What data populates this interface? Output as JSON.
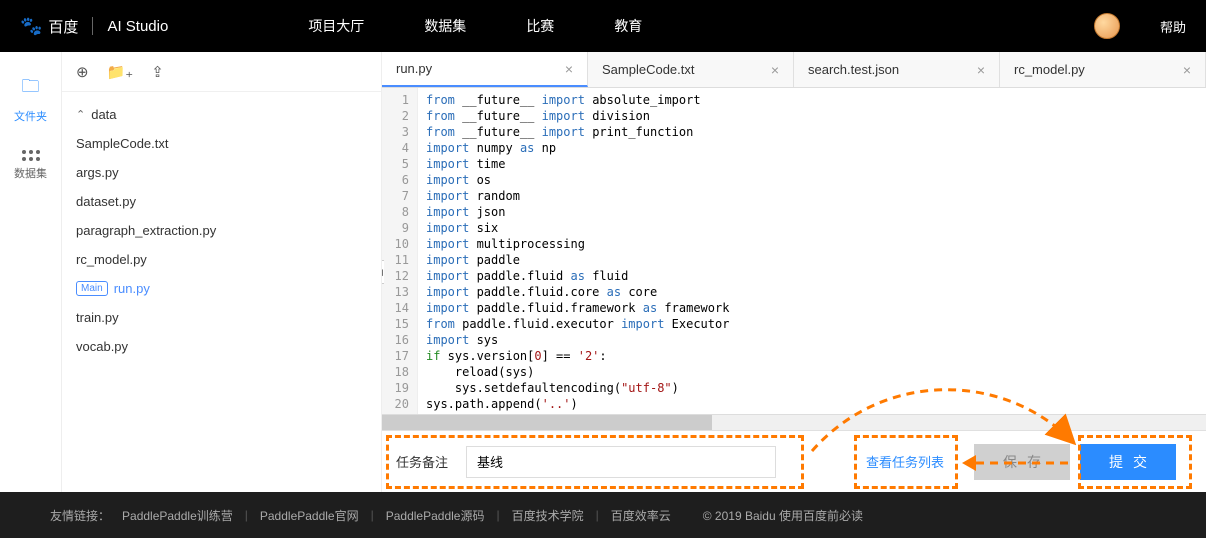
{
  "header": {
    "logo_baidu": "百度",
    "logo_studio": "AI Studio",
    "nav": [
      "项目大厅",
      "数据集",
      "比赛",
      "教育"
    ],
    "help": "帮助"
  },
  "leftcol": {
    "files": {
      "label": "文件夹"
    },
    "datasets": {
      "label": "数据集"
    }
  },
  "filetree": {
    "folder": "data",
    "items": [
      "SampleCode.txt",
      "args.py",
      "dataset.py",
      "paragraph_extraction.py",
      "rc_model.py"
    ],
    "main_tag": "Main",
    "main_file": "run.py",
    "rest": [
      "train.py",
      "vocab.py"
    ]
  },
  "tabs": [
    {
      "label": "run.py",
      "active": true
    },
    {
      "label": "SampleCode.txt",
      "active": false
    },
    {
      "label": "search.test.json",
      "active": false
    },
    {
      "label": "rc_model.py",
      "active": false
    }
  ],
  "code": {
    "lines": [
      [
        [
          "from",
          "kw-blue"
        ],
        [
          " __future__ ",
          ""
        ],
        [
          "import",
          "kw-blue"
        ],
        [
          " absolute_import",
          ""
        ]
      ],
      [
        [
          "from",
          "kw-blue"
        ],
        [
          " __future__ ",
          ""
        ],
        [
          "import",
          "kw-blue"
        ],
        [
          " division",
          ""
        ]
      ],
      [
        [
          "from",
          "kw-blue"
        ],
        [
          " __future__ ",
          ""
        ],
        [
          "import",
          "kw-blue"
        ],
        [
          " print_function",
          ""
        ]
      ],
      [
        [
          "",
          ""
        ]
      ],
      [
        [
          "import",
          "kw-blue"
        ],
        [
          " numpy ",
          ""
        ],
        [
          "as",
          "kw-blue"
        ],
        [
          " np",
          ""
        ]
      ],
      [
        [
          "import",
          "kw-blue"
        ],
        [
          " time",
          ""
        ]
      ],
      [
        [
          "import",
          "kw-blue"
        ],
        [
          " os",
          ""
        ]
      ],
      [
        [
          "import",
          "kw-blue"
        ],
        [
          " random",
          ""
        ]
      ],
      [
        [
          "import",
          "kw-blue"
        ],
        [
          " json",
          ""
        ]
      ],
      [
        [
          "import",
          "kw-blue"
        ],
        [
          " six",
          ""
        ]
      ],
      [
        [
          "import",
          "kw-blue"
        ],
        [
          " multiprocessing",
          ""
        ]
      ],
      [
        [
          "",
          ""
        ]
      ],
      [
        [
          "import",
          "kw-blue"
        ],
        [
          " paddle",
          ""
        ]
      ],
      [
        [
          "import",
          "kw-blue"
        ],
        [
          " paddle.fluid ",
          ""
        ],
        [
          "as",
          "kw-blue"
        ],
        [
          " fluid",
          ""
        ]
      ],
      [
        [
          "import",
          "kw-blue"
        ],
        [
          " paddle.fluid.core ",
          ""
        ],
        [
          "as",
          "kw-blue"
        ],
        [
          " core",
          ""
        ]
      ],
      [
        [
          "import",
          "kw-blue"
        ],
        [
          " paddle.fluid.framework ",
          ""
        ],
        [
          "as",
          "kw-blue"
        ],
        [
          " framework",
          ""
        ]
      ],
      [
        [
          "from",
          "kw-blue"
        ],
        [
          " paddle.fluid.executor ",
          ""
        ],
        [
          "import",
          "kw-blue"
        ],
        [
          " Executor",
          ""
        ]
      ],
      [
        [
          "",
          ""
        ]
      ],
      [
        [
          "import",
          "kw-blue"
        ],
        [
          " sys",
          ""
        ]
      ],
      [
        [
          "if",
          "kw-green"
        ],
        [
          " sys.version[",
          ""
        ],
        [
          "0",
          "num"
        ],
        [
          "] == ",
          ""
        ],
        [
          "'2'",
          "str"
        ],
        [
          ":",
          ""
        ]
      ],
      [
        [
          "    reload(sys)",
          ""
        ]
      ],
      [
        [
          "    sys.setdefaultencoding(",
          ""
        ],
        [
          "\"utf-8\"",
          "str"
        ],
        [
          ")",
          ""
        ]
      ],
      [
        [
          "sys.path.append(",
          ""
        ],
        [
          "'..'",
          "str"
        ],
        [
          ")",
          ""
        ]
      ],
      [
        [
          "",
          ""
        ]
      ]
    ]
  },
  "bottom": {
    "remark_label": "任务备注",
    "remark_value": "基线",
    "view_tasks": "查看任务列表",
    "save": "保存",
    "submit": "提交"
  },
  "footer": {
    "prefix": "友情链接：",
    "links": [
      "PaddlePaddle训练营",
      "PaddlePaddle官网",
      "PaddlePaddle源码",
      "百度技术学院",
      "百度效率云"
    ],
    "copyright": "© 2019 Baidu 使用百度前必读"
  }
}
